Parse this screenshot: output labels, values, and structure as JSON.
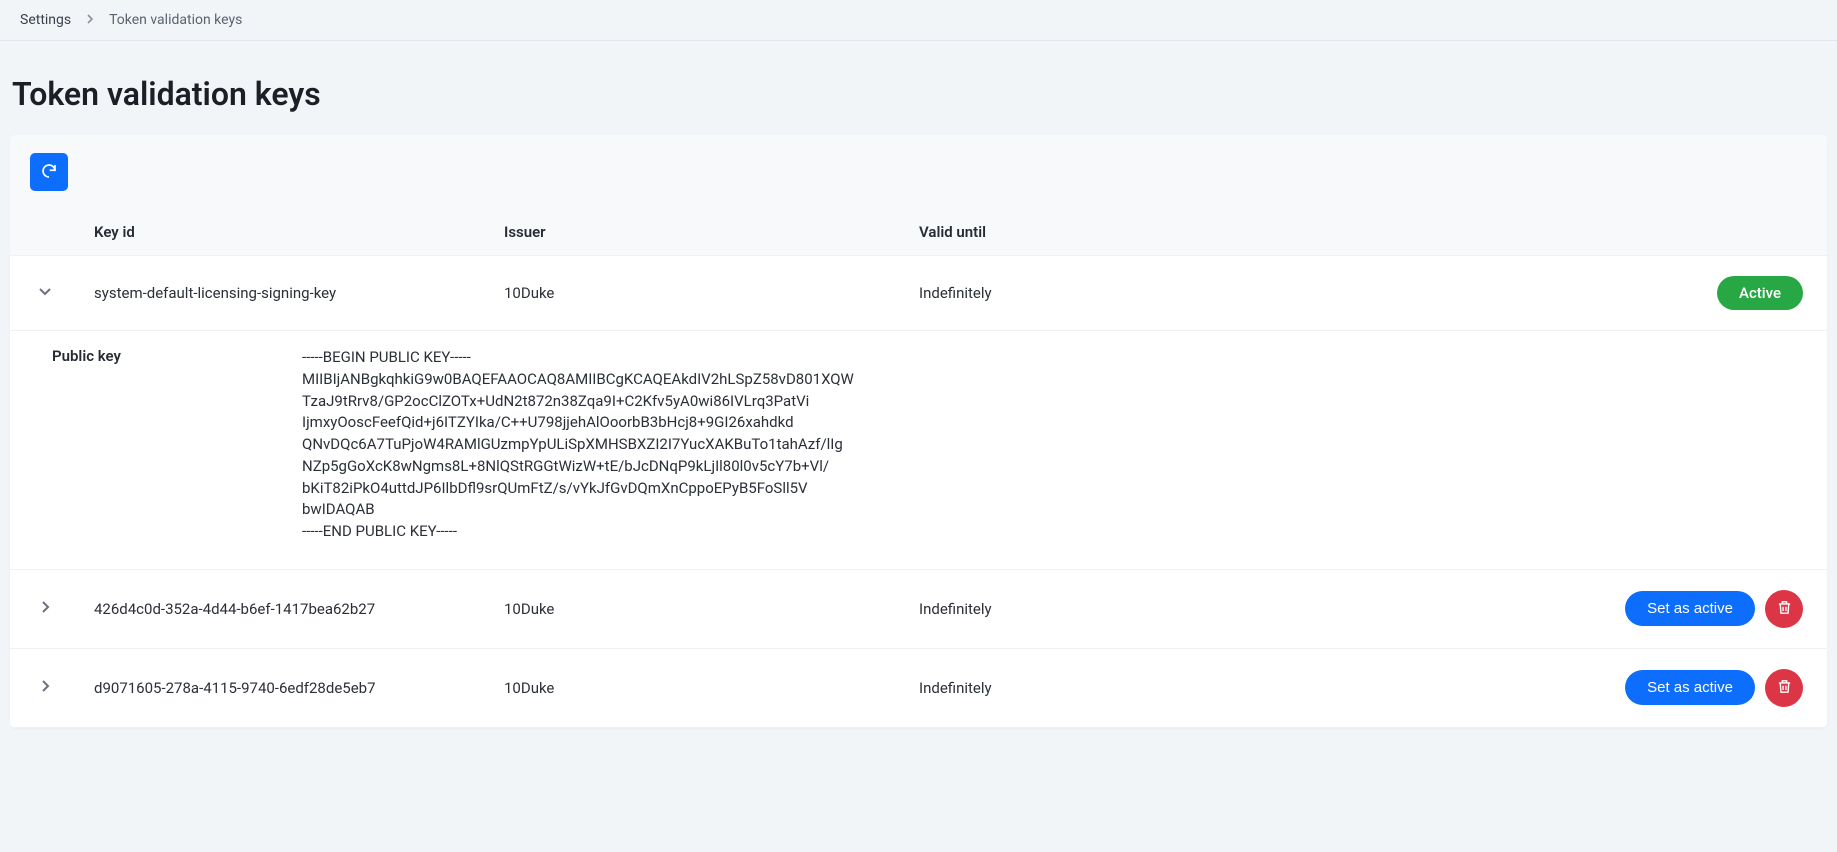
{
  "breadcrumb": {
    "root": "Settings",
    "current": "Token validation keys"
  },
  "page_title": "Token validation keys",
  "table": {
    "headers": {
      "key_id": "Key id",
      "issuer": "Issuer",
      "valid_until": "Valid until"
    },
    "expand_label": "Public key",
    "rows": [
      {
        "key_id": "system-default-licensing-signing-key",
        "issuer": "10Duke",
        "valid_until": "Indefinitely",
        "status": "active",
        "status_label": "Active",
        "expanded": true,
        "public_key": "-----BEGIN PUBLIC KEY-----\nMIIBIjANBgkqhkiG9w0BAQEFAAOCAQ8AMIIBCgKCAQEAkdIV2hLSpZ58vD801XQW\nTzaJ9tRrv8/GP2ocClZOTx+UdN2t872n38Zqa9I+C2Kfv5yA0wi86IVLrq3PatVi\nIjmxyOoscFeefQid+j6ITZYIka/C++U798jjehAlOoorbB3bHcj8+9GI26xahdkd\nQNvDQc6A7TuPjoW4RAMlGUzmpYpULiSpXMHSBXZI2I7YucXAKBuTo1tahAzf/lIg\nNZp5gGoXcK8wNgms8L+8NlQStRGGtWizW+tE/bJcDNqP9kLjIl80l0v5cY7b+Vl/\nbKiT82iPkO4uttdJP6IlbDfl9srQUmFtZ/s/vYkJfGvDQmXnCppoEPyB5FoSll5V\nbwIDAQAB\n-----END PUBLIC KEY-----"
      },
      {
        "key_id": "426d4c0d-352a-4d44-b6ef-1417bea62b27",
        "issuer": "10Duke",
        "valid_until": "Indefinitely",
        "status": "inactive",
        "action_label": "Set as active",
        "expanded": false
      },
      {
        "key_id": "d9071605-278a-4115-9740-6edf28de5eb7",
        "issuer": "10Duke",
        "valid_until": "Indefinitely",
        "status": "inactive",
        "action_label": "Set as active",
        "expanded": false
      }
    ]
  }
}
